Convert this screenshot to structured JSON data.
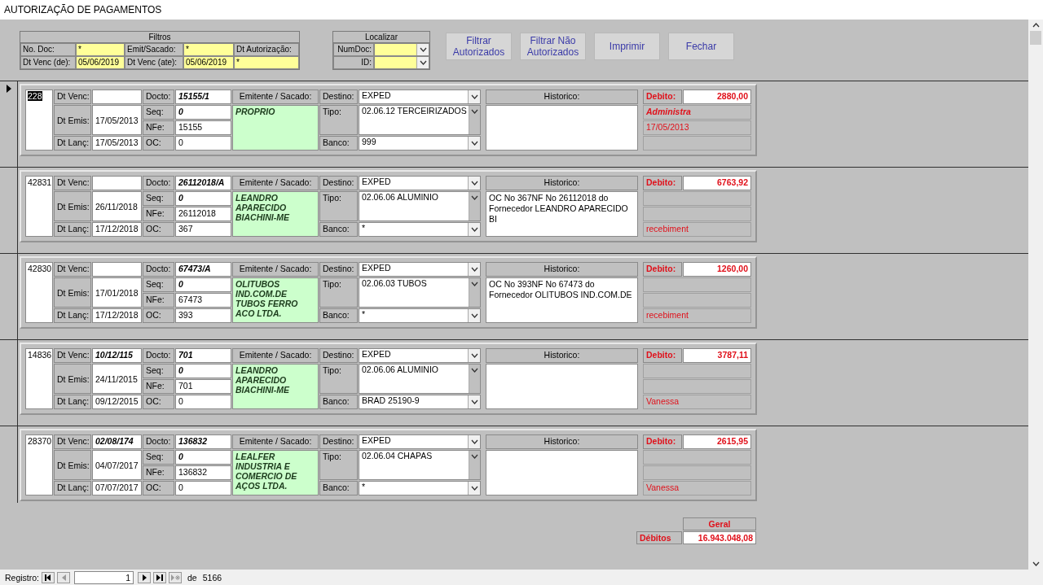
{
  "window": {
    "title": "AUTORIZAÇÃO DE PAGAMENTOS"
  },
  "filters": {
    "title": "Filtros",
    "rows": [
      [
        {
          "label": "No. Doc:",
          "value": "*"
        },
        {
          "label": "Emit/Sacado:",
          "value": "*"
        },
        {
          "label": "Dt Autorização:"
        }
      ],
      [
        {
          "label": "Dt Venc (de):",
          "value": "05/06/2019"
        },
        {
          "label": "Dt Venc (ate):",
          "value": "05/06/2019"
        },
        {
          "value": "*"
        }
      ]
    ]
  },
  "locate": {
    "title": "Localizar",
    "fields": [
      {
        "label": "NumDoc:"
      },
      {
        "label": "ID:"
      }
    ]
  },
  "buttons": [
    "Filtrar Autorizados",
    "Filtrar Não Autorizados",
    "Imprimir",
    "Fechar"
  ],
  "records": [
    {
      "selected": true,
      "id": "228",
      "labels": [
        "Dt Venc:",
        "Dt Emis:",
        "Dt Lanç:",
        "Docto:",
        "Seq:",
        "NFe:",
        "OC:",
        "Emitente / Sacado:",
        "Destino:",
        "Tipo:",
        "Banco:",
        "Historico:",
        "Debito:"
      ],
      "dt_emis": "17/05/2013",
      "dt_lanc": "17/05/2013",
      "docto": "15155/1",
      "seq": "0",
      "nfe": "15155",
      "oc": "0",
      "emitente": "PROPRIO",
      "destino": "EXPED",
      "tipo": "02.06.12 TERCEIRIZADOS",
      "banco": "999",
      "debito": "2880,00",
      "notes": {
        "top": {
          "text": "Administra",
          "emphasized": true
        },
        "middle": {
          "text": "17/05/2013",
          "emphasized": false
        }
      }
    },
    {
      "selected": false,
      "id": "42831",
      "labels": [
        "Dt Venc:",
        "Dt Emis:",
        "Dt Lanç:",
        "Docto:",
        "Seq:",
        "NFe:",
        "OC:",
        "Emitente / Sacado:",
        "Destino:",
        "Tipo:",
        "Banco:",
        "Historico:",
        "Debito:"
      ],
      "dt_emis": "26/11/2018",
      "dt_lanc": "17/12/2018",
      "docto": "26112018/A",
      "seq": "0",
      "nfe": "26112018",
      "oc": "367",
      "emitente": "LEANDRO APARECIDO BIACHINI-ME",
      "destino": "EXPED",
      "tipo": "02.06.06 ALUMINIO",
      "banco": "*",
      "historico": "OC No 367NF No 26112018 do Fornecedor LEANDRO APARECIDO BI",
      "debito": "6763,92",
      "notes": {
        "bottom": {
          "text": "recebiment",
          "emphasized": false
        }
      }
    },
    {
      "selected": false,
      "id": "42830",
      "labels": [
        "Dt Venc:",
        "Dt Emis:",
        "Dt Lanç:",
        "Docto:",
        "Seq:",
        "NFe:",
        "OC:",
        "Emitente / Sacado:",
        "Destino:",
        "Tipo:",
        "Banco:",
        "Historico:",
        "Debito:"
      ],
      "dt_emis": "17/01/2018",
      "dt_lanc": "17/12/2018",
      "docto": "67473/A",
      "seq": "0",
      "nfe": "67473",
      "oc": "393",
      "emitente": "OLITUBOS IND.COM.DE TUBOS FERRO ACO LTDA.",
      "destino": "EXPED",
      "tipo": "02.06.03 TUBOS",
      "banco": "*",
      "historico": "OC No 393NF No 67473 do Fornecedor OLITUBOS IND.COM.DE",
      "debito": "1260,00",
      "notes": {
        "bottom": {
          "text": "recebiment",
          "emphasized": false
        }
      }
    },
    {
      "selected": false,
      "id": "14836",
      "labels": [
        "Dt Venc:",
        "Dt Emis:",
        "Dt Lanç:",
        "Docto:",
        "Seq:",
        "NFe:",
        "OC:",
        "Emitente / Sacado:",
        "Destino:",
        "Tipo:",
        "Banco:",
        "Historico:",
        "Debito:"
      ],
      "dt_venc": "10/12/115",
      "dt_emis": "24/11/2015",
      "dt_lanc": "09/12/2015",
      "docto": "701",
      "seq": "0",
      "nfe": "701",
      "oc": "0",
      "emitente": "LEANDRO APARECIDO BIACHINI-ME",
      "destino": "EXPED",
      "tipo": "02.06.06 ALUMINIO",
      "banco": "BRAD 25190-9",
      "debito": "3787,11",
      "notes": {
        "bottom": {
          "text": "Vanessa",
          "emphasized": false
        }
      }
    },
    {
      "selected": false,
      "id": "28370",
      "labels": [
        "Dt Venc:",
        "Dt Emis:",
        "Dt Lanç:",
        "Docto:",
        "Seq:",
        "NFe:",
        "OC:",
        "Emitente / Sacado:",
        "Destino:",
        "Tipo:",
        "Banco:",
        "Historico:",
        "Debito:"
      ],
      "dt_venc": "02/08/174",
      "dt_emis": "04/07/2017",
      "dt_lanc": "07/07/2017",
      "docto": "136832",
      "seq": "0",
      "nfe": "136832",
      "oc": "0",
      "emitente": "LEALFER INDUSTRIA E COMERCIO DE AÇOS LTDA.",
      "destino": "EXPED",
      "tipo": "02.06.04 CHAPAS",
      "banco": "*",
      "debito": "2615,95",
      "notes": {
        "bottom": {
          "text": "Vanessa",
          "emphasized": false
        }
      }
    }
  ],
  "totals": {
    "header": "Geral",
    "label": "Débitos",
    "value": "16.943.048,08"
  },
  "status_bar": {
    "label": "Registro:",
    "current": "1",
    "of": "de",
    "total": "5166",
    "nav_buttons": [
      {
        "kind": "first",
        "disabled": false
      },
      {
        "kind": "prev",
        "disabled": true
      },
      {
        "kind": "next",
        "disabled": false
      },
      {
        "kind": "last",
        "disabled": false
      },
      {
        "kind": "new",
        "disabled": true
      }
    ]
  }
}
